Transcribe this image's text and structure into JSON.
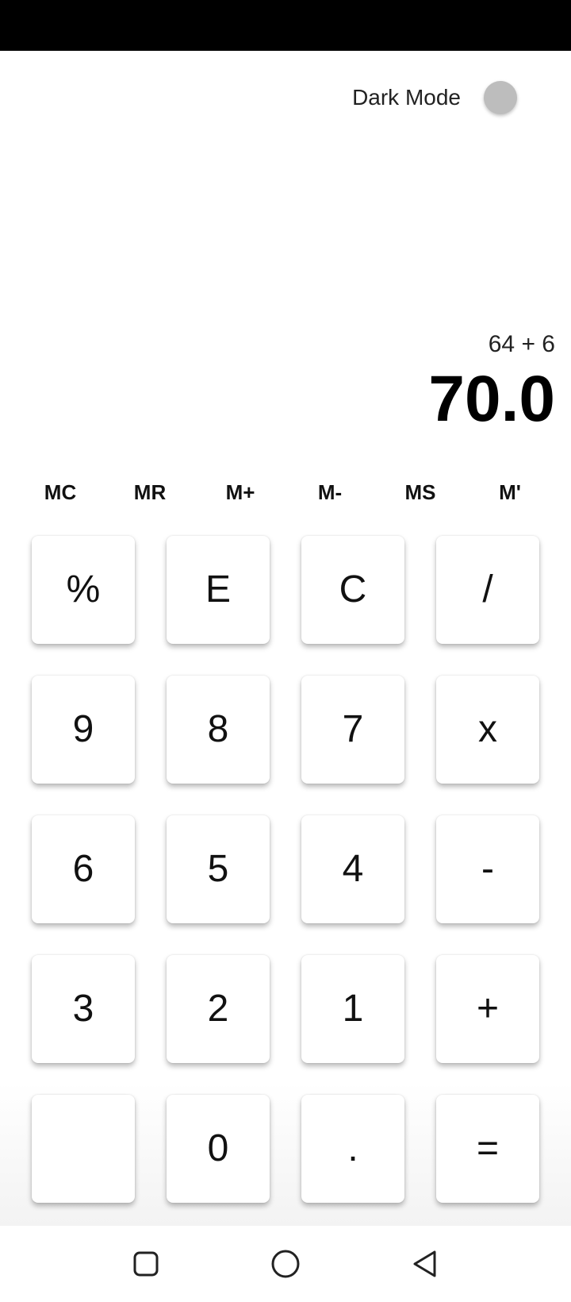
{
  "settings": {
    "dark_mode_label": "Dark Mode"
  },
  "display": {
    "expression": "64 + 6",
    "result": "70.0"
  },
  "memory": {
    "buttons": [
      "MC",
      "MR",
      "M+",
      "M-",
      "MS",
      "M'"
    ]
  },
  "keypad": {
    "rows": [
      [
        "%",
        "E",
        "C",
        "/"
      ],
      [
        "9",
        "8",
        "7",
        "x"
      ],
      [
        "6",
        "5",
        "4",
        "-"
      ],
      [
        "3",
        "2",
        "1",
        "+"
      ],
      [
        "",
        "0",
        ".",
        "="
      ]
    ]
  },
  "nav": {
    "icons": [
      "recent-apps-icon",
      "home-icon",
      "back-icon"
    ]
  },
  "colors": {
    "status_bar": "#000000",
    "toggle_off": "#bdbdbd",
    "key_bg": "#ffffff"
  }
}
